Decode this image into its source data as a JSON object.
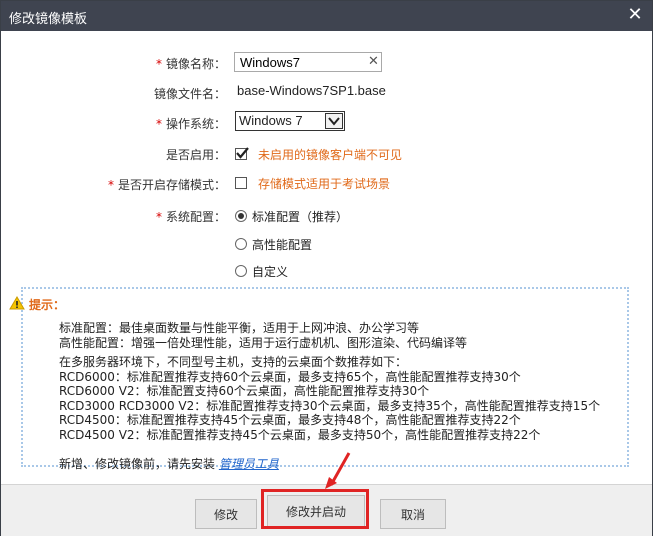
{
  "dialog": {
    "title": "修改镜像模板",
    "close_glyph": "✕"
  },
  "form": {
    "required_mark": "*",
    "image_name": {
      "label": "镜像名称：",
      "value": "Windows7",
      "clear_glyph": "✕"
    },
    "image_file": {
      "label": "镜像文件名：",
      "value": "base-Windows7SP1.base"
    },
    "os": {
      "label": "操作系统：",
      "selected": "Windows 7"
    },
    "enabled": {
      "label": "是否启用：",
      "checked": true,
      "hint": "未启用的镜像客户端不可见"
    },
    "storage_mode": {
      "label": "是否开启存储模式：",
      "checked": false,
      "hint": "存储模式适用于考试场景"
    },
    "system_config": {
      "label": "系统配置：",
      "options": [
        {
          "label": "标准配置（推荐）",
          "selected": true
        },
        {
          "label": "高性能配置",
          "selected": false
        },
        {
          "label": "自定义",
          "selected": false
        }
      ]
    }
  },
  "tips": {
    "title": "提示：",
    "lines": [
      "标准配置：最佳桌面数量与性能平衡，适用于上网冲浪、办公学习等",
      "高性能配置：增强一倍处理性能，适用于运行虚机机、图形渲染、代码编译等",
      "在多服务器环境下，不同型号主机，支持的云桌面个数推荐如下：",
      "RCD6000：标准配置推荐支持60个云桌面，最多支持65个，高性能配置推荐支持30个",
      "RCD6000 V2：标准配置支持60个云桌面，高性能配置推荐支持30个",
      "RCD3000 RCD3000 V2：标准配置推荐支持30个云桌面，最多支持35个，高性能配置推荐支持15个",
      "RCD4500：标准配置推荐支持45个云桌面，最多支持48个，高性能配置推荐支持22个",
      "RCD4500 V2：标准配置推荐支持45个云桌面，最多支持50个，高性能配置推荐支持22个"
    ],
    "install_prefix": "新增、修改镜像前，请先安装",
    "install_link": "管理员工具"
  },
  "buttons": {
    "modify": "修改",
    "modify_and_start": "修改并启动",
    "cancel": "取消"
  },
  "colors": {
    "titlebar": "#3f4450",
    "hint": "#e06a1a",
    "required": "#d60000",
    "highlight": "#e02424",
    "link": "#2266cc"
  }
}
